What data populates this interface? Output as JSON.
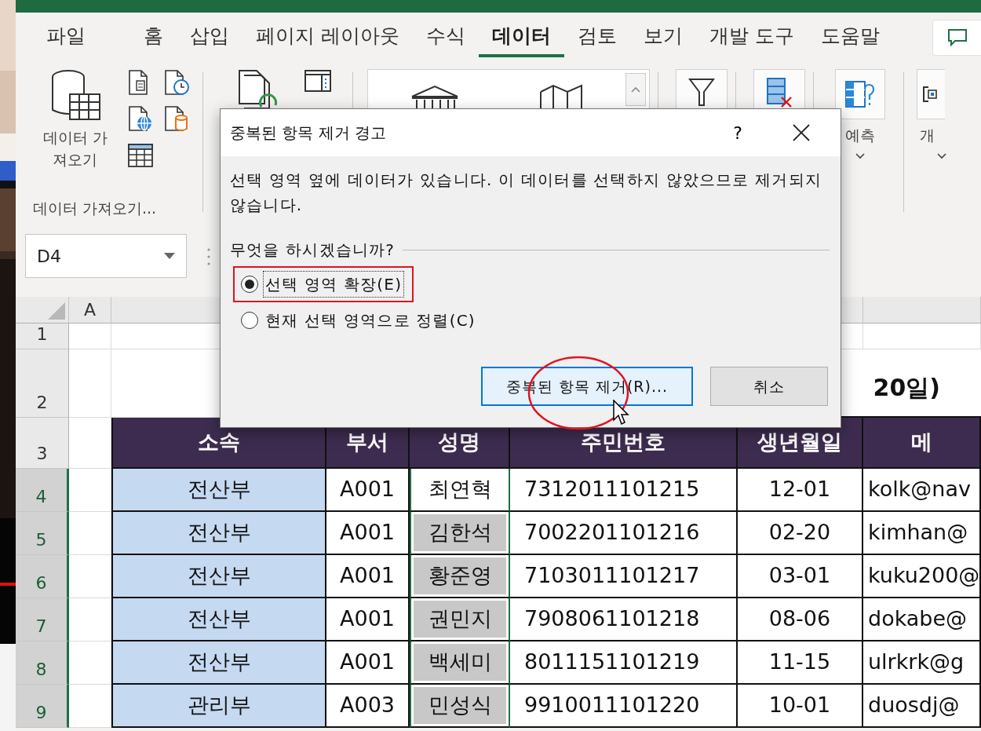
{
  "ribbon_tabs": [
    {
      "label": "파일",
      "selected": false
    },
    {
      "label": "홈",
      "selected": false
    },
    {
      "label": "삽입",
      "selected": false
    },
    {
      "label": "페이지 레이아웃",
      "selected": false
    },
    {
      "label": "수식",
      "selected": false
    },
    {
      "label": "데이터",
      "selected": true
    },
    {
      "label": "검토",
      "selected": false
    },
    {
      "label": "보기",
      "selected": false
    },
    {
      "label": "개발 도구",
      "selected": false
    },
    {
      "label": "도움말",
      "selected": false
    }
  ],
  "ribbon": {
    "get_data_lines": [
      "데이터 가",
      "져오기"
    ],
    "get_data_group_label": "데이터 가져오기...",
    "forecast_label": "예측",
    "next_group_label": "개"
  },
  "name_box": {
    "value": "D4"
  },
  "column_headers": [
    "A"
  ],
  "row_headers": [
    {
      "label": "1",
      "selected": false
    },
    {
      "label": "2",
      "selected": false
    },
    {
      "label": "3",
      "selected": false
    },
    {
      "label": "4",
      "selected": true
    },
    {
      "label": "5",
      "selected": true
    },
    {
      "label": "6",
      "selected": true
    },
    {
      "label": "7",
      "selected": true
    },
    {
      "label": "8",
      "selected": true
    },
    {
      "label": "9",
      "selected": true
    }
  ],
  "sheet_title": "20일)",
  "table": {
    "columns": [
      "소속",
      "부서",
      "성명",
      "주민번호",
      "생년월일",
      "메"
    ],
    "rows": [
      {
        "cells": [
          "전산부",
          "A001",
          "최연혁",
          "7312011101215",
          "12-01",
          "kolk@nav"
        ],
        "active": true
      },
      {
        "cells": [
          "전산부",
          "A001",
          "김한석",
          "7002201101216",
          "02-20",
          "kimhan@"
        ],
        "active": false
      },
      {
        "cells": [
          "전산부",
          "A001",
          "황준영",
          "7103011101217",
          "03-01",
          "kuku200@"
        ],
        "active": false
      },
      {
        "cells": [
          "전산부",
          "A001",
          "권민지",
          "7908061101218",
          "08-06",
          "dokabe@"
        ],
        "active": false
      },
      {
        "cells": [
          "전산부",
          "A001",
          "백세미",
          "8011151101219",
          "11-15",
          "ulrkrk@g"
        ],
        "active": false
      },
      {
        "cells": [
          "관리부",
          "A003",
          "민성식",
          "9910011101220",
          "10-01",
          "duosdj@"
        ],
        "active": false
      }
    ]
  },
  "dialog": {
    "title": "중복된 항목 제거 경고",
    "help": "?",
    "message": "선택 영역 옆에 데이터가 있습니다. 이 데이터를 선택하지 않았으므로 제거되지 않습니다.",
    "question": "무엇을 하시겠습니까?",
    "options": [
      {
        "label": "선택 영역 확장(E)",
        "selected": true,
        "highlighted": true
      },
      {
        "label": "현재 선택 영역으로 정렬(C)",
        "selected": false,
        "highlighted": false
      }
    ],
    "buttons": [
      {
        "label": "중복된 항목 제거(R)...",
        "default": true
      },
      {
        "label": "취소",
        "default": false
      }
    ]
  }
}
